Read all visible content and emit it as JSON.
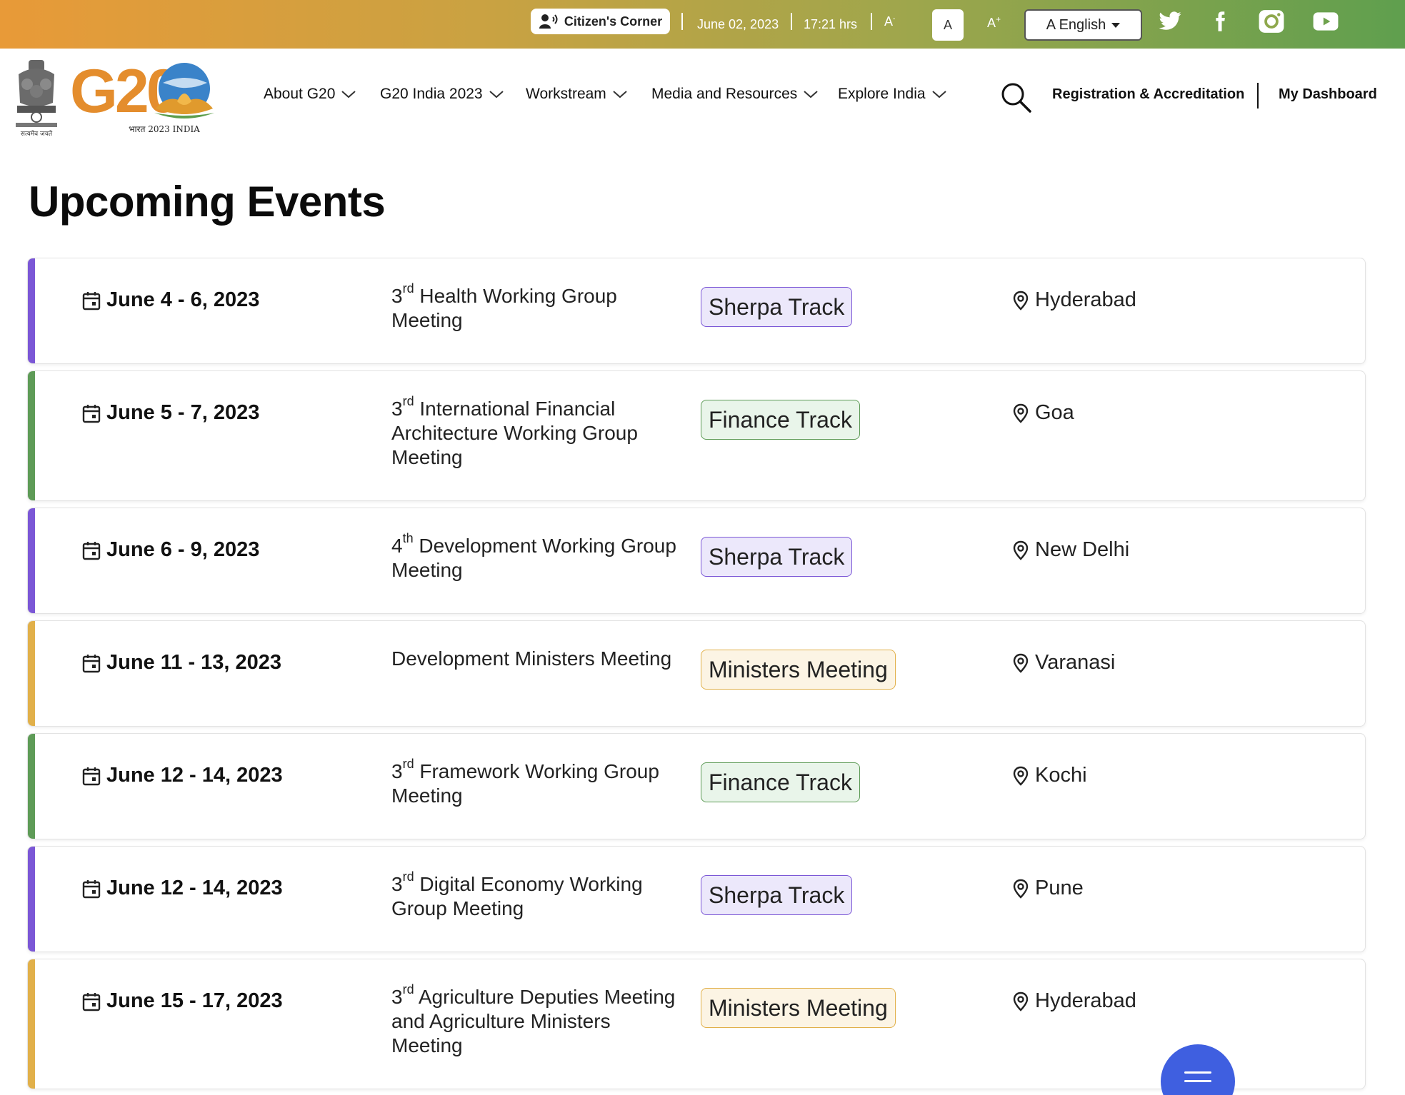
{
  "topbar": {
    "citizens_corner": "Citizen's Corner",
    "date": "June 02, 2023",
    "time": "17:21 hrs",
    "font_small": "A",
    "font_small_suffix": "-",
    "font_normal": "A",
    "font_large": "A",
    "font_large_suffix": "+",
    "language": "A English",
    "social_icons": [
      "twitter-icon",
      "facebook-icon",
      "instagram-icon",
      "youtube-icon"
    ]
  },
  "header": {
    "emblem_caption": "सत्यमेव जयते",
    "logo_text": "G20",
    "logo_caption": "भारत 2023 INDIA",
    "nav": [
      "About G20",
      "G20 India 2023",
      "Workstream",
      "Media and Resources",
      "Explore India"
    ],
    "registration": "Registration & Accreditation",
    "dashboard": "My Dashboard"
  },
  "page_title": "Upcoming Events",
  "colors": {
    "sherpa": "#7b57d6",
    "finance": "#5e9b57",
    "ministers": "#e1b04a",
    "fab": "#3f5fe0"
  },
  "events": [
    {
      "date": "June 4 - 6, 2023",
      "ordinal_num": "3",
      "ordinal_sup": "rd",
      "title": " Health Working Group Meeting",
      "track": "Sherpa Track",
      "track_type": "sherpa",
      "location": "Hyderabad"
    },
    {
      "date": "June 5 - 7, 2023",
      "ordinal_num": "3",
      "ordinal_sup": "rd",
      "title": " International Financial Architecture Working Group Meeting",
      "track": "Finance Track",
      "track_type": "finance",
      "location": "Goa"
    },
    {
      "date": "June 6 - 9, 2023",
      "ordinal_num": "4",
      "ordinal_sup": "th",
      "title": " Development Working Group Meeting",
      "track": "Sherpa Track",
      "track_type": "sherpa",
      "location": "New Delhi"
    },
    {
      "date": "June 11 - 13, 2023",
      "ordinal_num": "",
      "ordinal_sup": "",
      "title": "Development Ministers Meeting",
      "track": "Ministers Meeting",
      "track_type": "ministers",
      "location": "Varanasi"
    },
    {
      "date": "June 12 - 14, 2023",
      "ordinal_num": "3",
      "ordinal_sup": "rd",
      "title": " Framework Working Group Meeting",
      "track": "Finance Track",
      "track_type": "finance",
      "location": "Kochi"
    },
    {
      "date": "June 12 - 14, 2023",
      "ordinal_num": "3",
      "ordinal_sup": "rd",
      "title": " Digital Economy Working Group Meeting",
      "track": "Sherpa Track",
      "track_type": "sherpa",
      "location": "Pune"
    },
    {
      "date": "June 15 - 17, 2023",
      "ordinal_num": "3",
      "ordinal_sup": "rd",
      "title": " Agriculture Deputies Meeting and Agriculture Ministers Meeting",
      "track": "Ministers Meeting",
      "track_type": "ministers",
      "location": "Hyderabad"
    }
  ]
}
